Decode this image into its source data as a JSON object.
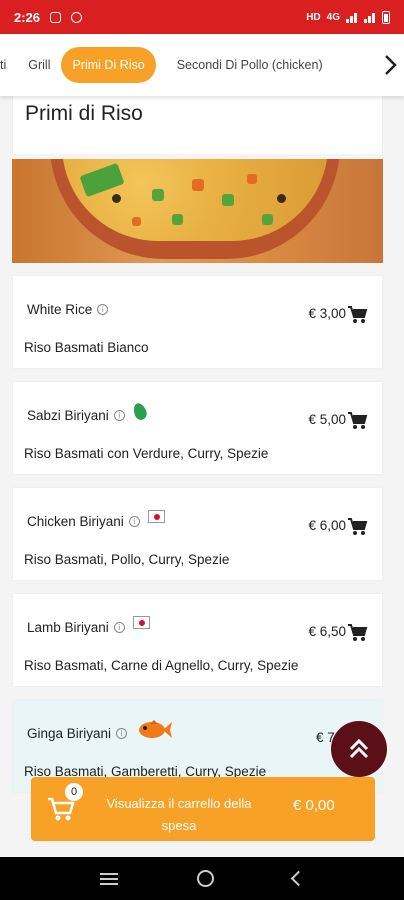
{
  "status_bar": {
    "time": "2:26",
    "network": "4G"
  },
  "tabs": [
    {
      "label": "ti",
      "active": false
    },
    {
      "label": "Grill",
      "active": false
    },
    {
      "label": "Primi Di Riso",
      "active": true
    },
    {
      "label": "Secondi Di Pollo (chicken)",
      "active": false
    }
  ],
  "section": {
    "title": "Primi di Riso"
  },
  "items": [
    {
      "name": "White Rice",
      "desc": "Riso Basmati Bianco",
      "price": "€ 3,00",
      "badge": null
    },
    {
      "name": "Sabzi Biriyani",
      "desc": "Riso Basmati con Verdure, Curry, Spezie",
      "price": "€ 5,00",
      "badge": "leaf-icon"
    },
    {
      "name": "Chicken Biriyani",
      "desc": "Riso Basmati, Pollo, Curry, Spezie",
      "price": "€ 6,00",
      "badge": "japan-flag-icon"
    },
    {
      "name": "Lamb Biriyani",
      "desc": "Riso Basmati, Carne di Agnello, Curry, Spezie",
      "price": "€ 6,50",
      "badge": "japan-flag-icon"
    },
    {
      "name": "Ginga Biriyani",
      "desc": "Riso Basmati, Gamberetti, Curry, Spezie",
      "price": "€ 7,0",
      "badge": "fish-icon"
    }
  ],
  "cart": {
    "count": "0",
    "label": "Visualizza il carrello della spesa",
    "total": "€ 0,00"
  },
  "colors": {
    "status_bar": "#d91f1f",
    "accent": "#f7a127",
    "dark": "#5b0f17",
    "highlight": "#eaf5f8"
  }
}
